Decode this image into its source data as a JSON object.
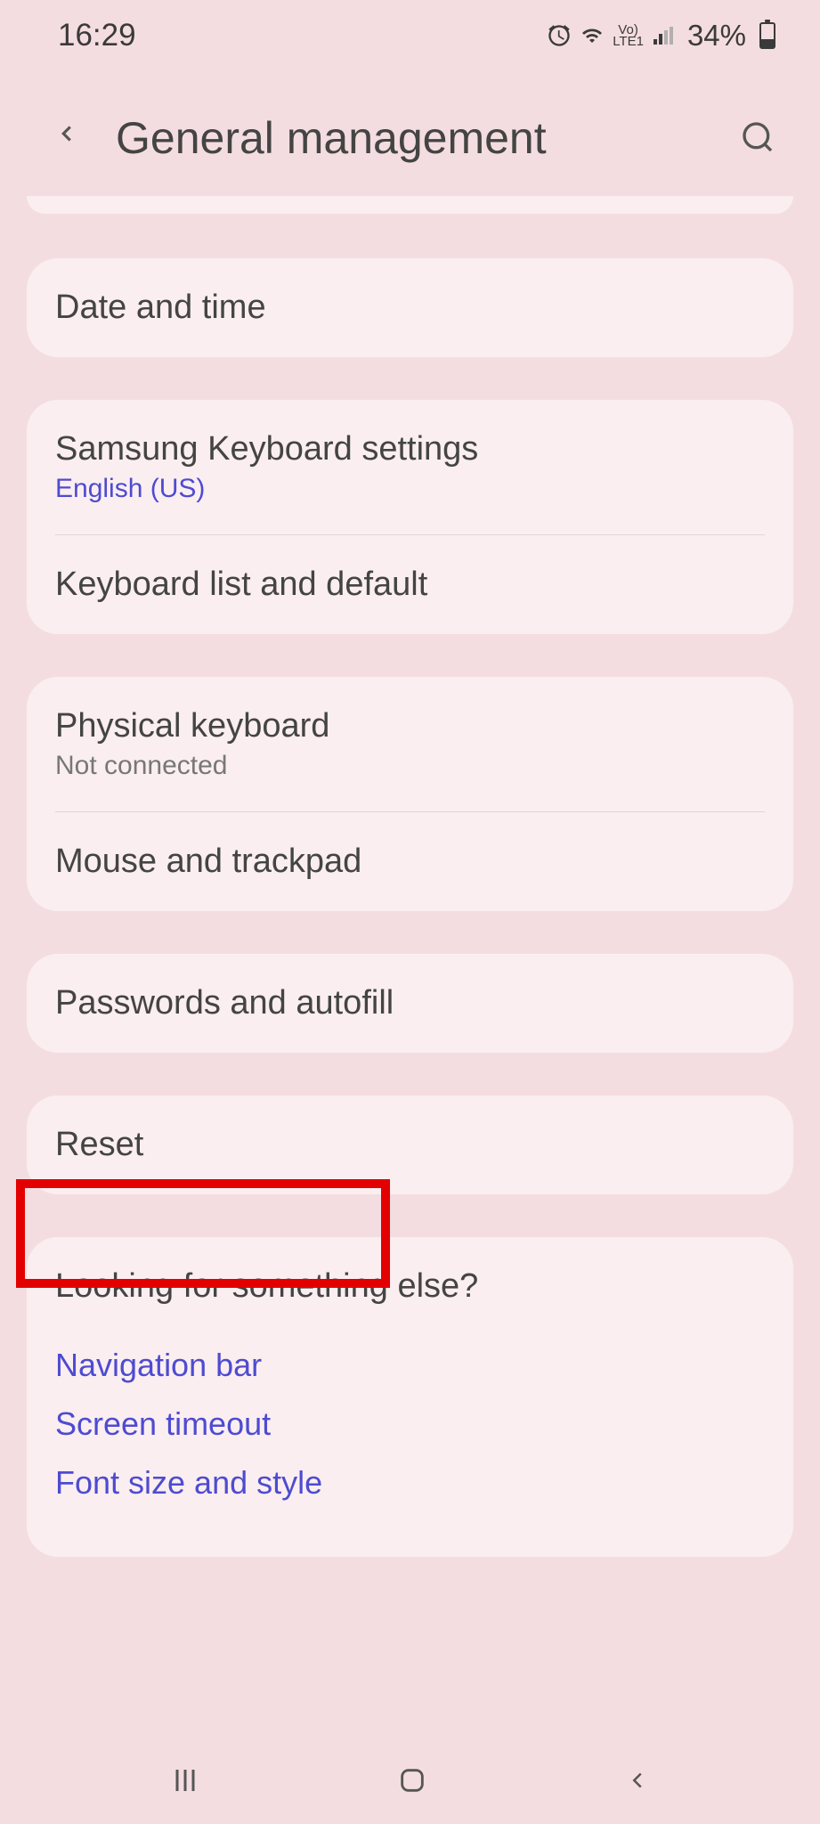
{
  "statusBar": {
    "time": "16:29",
    "batteryPercent": "34%",
    "lte": "LTE1",
    "vo": "Vo)"
  },
  "header": {
    "title": "General management"
  },
  "items": {
    "dateTime": "Date and time",
    "samsungKeyboard": {
      "title": "Samsung Keyboard settings",
      "subtitle": "English (US)"
    },
    "keyboardList": "Keyboard list and default",
    "physicalKeyboard": {
      "title": "Physical keyboard",
      "subtitle": "Not connected"
    },
    "mouseTrackpad": "Mouse and trackpad",
    "passwordsAutofill": "Passwords and autofill",
    "reset": "Reset"
  },
  "related": {
    "title": "Looking for something else?",
    "links": {
      "navBar": "Navigation bar",
      "screenTimeout": "Screen timeout",
      "fontSize": "Font size and style"
    }
  }
}
